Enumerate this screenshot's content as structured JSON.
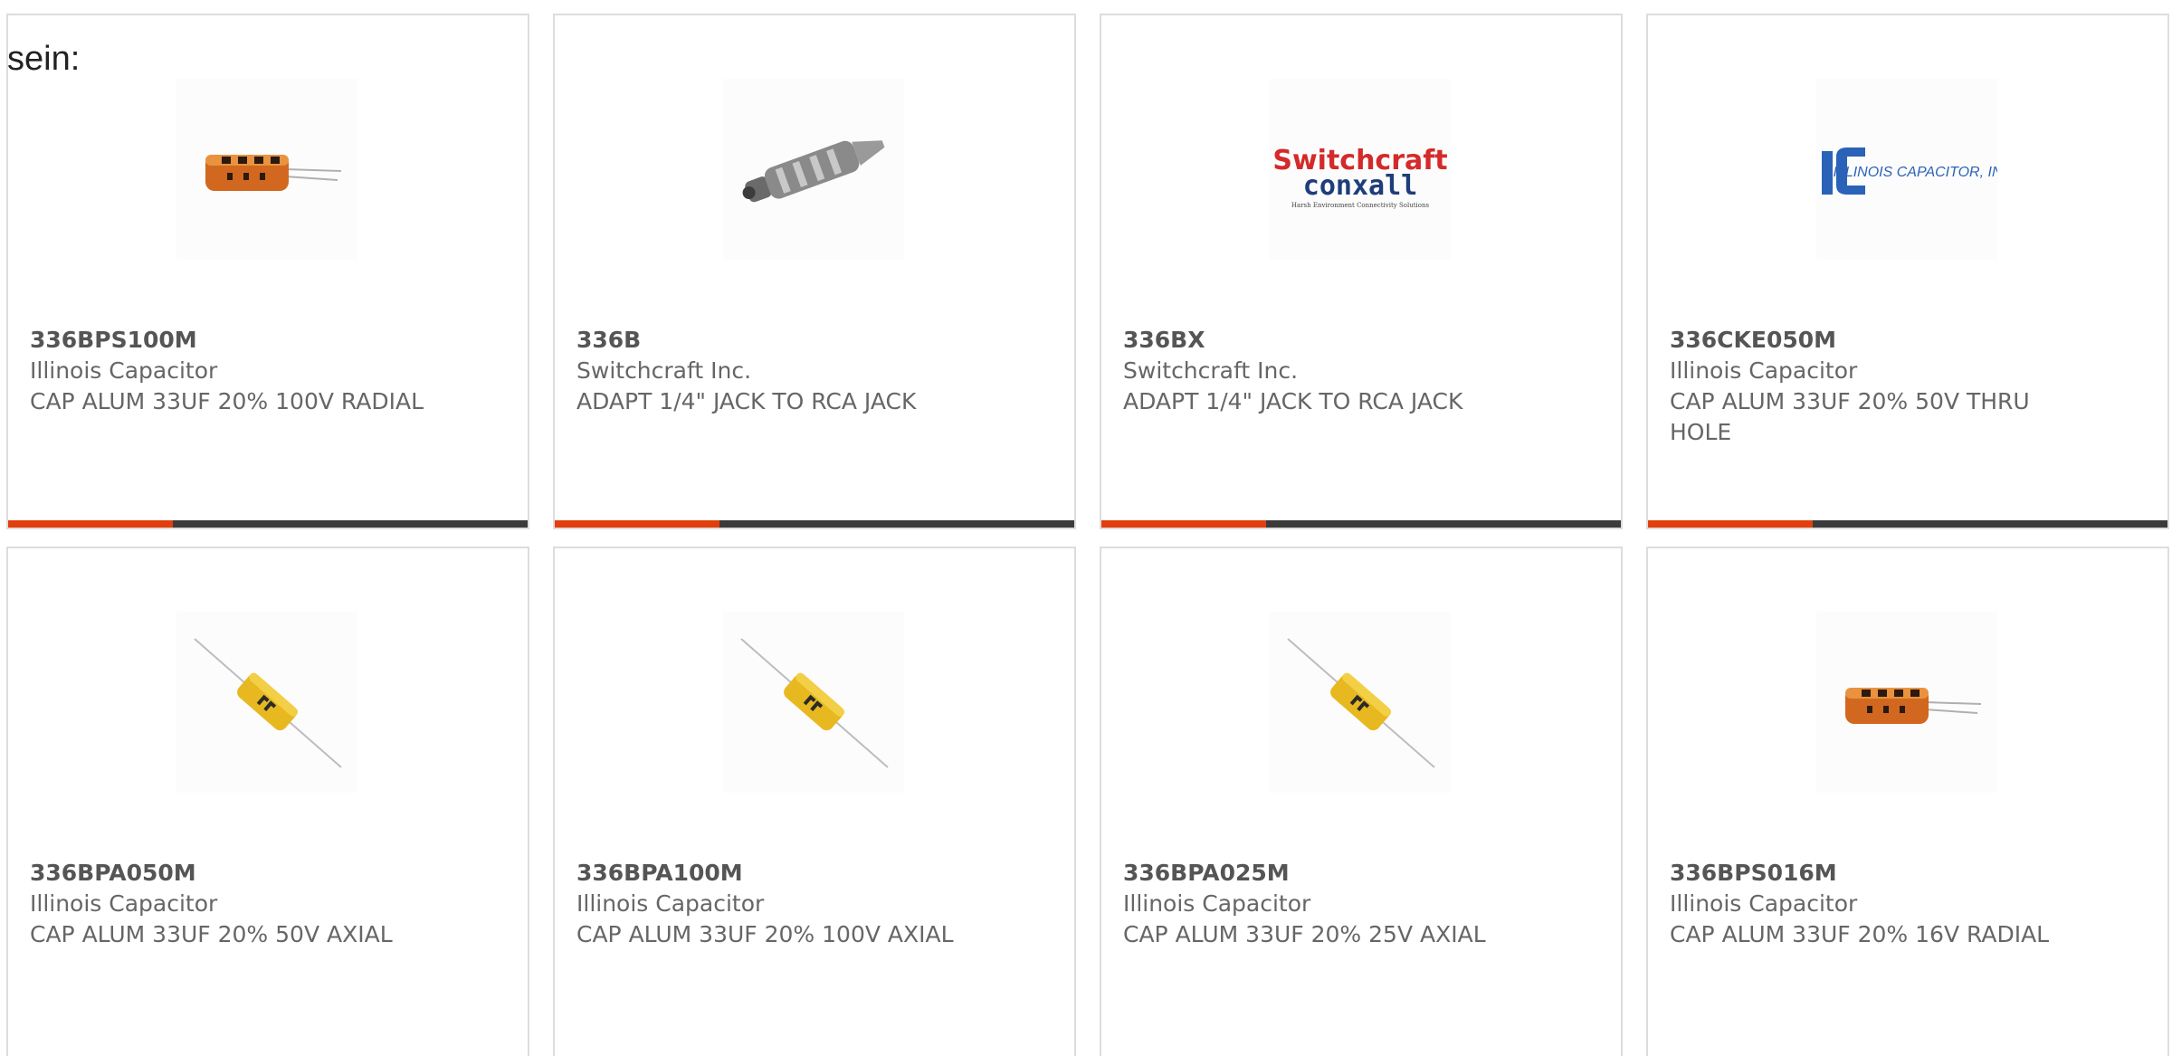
{
  "intro_text": "sein:",
  "colors": {
    "accent": "#e1400e",
    "bar": "#3a3a3a",
    "border": "#dddddd"
  },
  "products": [
    {
      "part": "336BPS100M",
      "manufacturer": "Illinois Capacitor",
      "description": "CAP ALUM 33UF 20% 100V RADIAL",
      "image": "radial-capacitor-image"
    },
    {
      "part": "336B",
      "manufacturer": "Switchcraft Inc.",
      "description": "ADAPT 1/4\" JACK TO RCA JACK",
      "image": "jack-adapter-image"
    },
    {
      "part": "336BX",
      "manufacturer": "Switchcraft Inc.",
      "description": "ADAPT 1/4\" JACK TO RCA JACK",
      "image": "switchcraft-conxall-logo",
      "logo_line1": "Switchcraft",
      "logo_line2": "conxall",
      "logo_tag": "Harsh Environment Connectivity Solutions"
    },
    {
      "part": "336CKE050M",
      "manufacturer": "Illinois Capacitor",
      "description": "CAP ALUM 33UF 20% 50V THRU HOLE",
      "image": "illinois-capacitor-logo",
      "logo_text": "ILLINOIS CAPACITOR, INC."
    },
    {
      "part": "336BPA050M",
      "manufacturer": "Illinois Capacitor",
      "description": "CAP ALUM 33UF 20% 50V AXIAL",
      "image": "axial-capacitor-image"
    },
    {
      "part": "336BPA100M",
      "manufacturer": "Illinois Capacitor",
      "description": "CAP ALUM 33UF 20% 100V AXIAL",
      "image": "axial-capacitor-image"
    },
    {
      "part": "336BPA025M",
      "manufacturer": "Illinois Capacitor",
      "description": "CAP ALUM 33UF 20% 25V AXIAL",
      "image": "axial-capacitor-image"
    },
    {
      "part": "336BPS016M",
      "manufacturer": "Illinois Capacitor",
      "description": "CAP ALUM 33UF 20% 16V RADIAL",
      "image": "radial-capacitor-image"
    }
  ]
}
